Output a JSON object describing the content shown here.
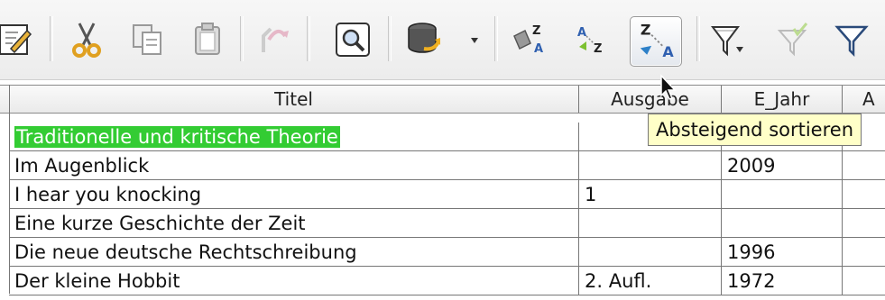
{
  "toolbar": {
    "buttons": [
      {
        "name": "edit-data-button",
        "icon": "edit-icon"
      },
      {
        "name": "cut-button",
        "icon": "scissors-icon"
      },
      {
        "name": "copy-button",
        "icon": "copy-icon"
      },
      {
        "name": "paste-button",
        "icon": "paste-icon"
      },
      {
        "name": "undo-button",
        "icon": "undo-icon"
      },
      {
        "name": "find-record-button",
        "icon": "magnifier-icon"
      },
      {
        "name": "data-source-button",
        "icon": "database-icon"
      },
      {
        "name": "sort-button",
        "icon": "sort-icon"
      },
      {
        "name": "sort-ascending-button",
        "icon": "sort-ascending-icon"
      },
      {
        "name": "sort-descending-button",
        "icon": "sort-descending-icon"
      },
      {
        "name": "autofilter-button",
        "icon": "funnel-icon"
      },
      {
        "name": "apply-filter-button",
        "icon": "funnel-check-icon"
      },
      {
        "name": "standard-filter-button",
        "icon": "funnel-outline-icon"
      }
    ],
    "glyphs": {
      "sort_z": "Z",
      "sort_a": "A",
      "asc_a": "A",
      "asc_z": "Z",
      "desc_z": "Z",
      "desc_a": "A"
    }
  },
  "tooltip": "Absteigend sortieren",
  "table": {
    "columns": [
      "Titel",
      "Ausgabe",
      "E_Jahr",
      "A"
    ],
    "rows": [
      [
        "Traditionelle und kritische Theorie",
        "",
        ""
      ],
      [
        "Im Augenblick",
        "",
        "2009"
      ],
      [
        "I hear you knocking",
        "1",
        ""
      ],
      [
        "Eine kurze Geschichte der Zeit",
        "",
        ""
      ],
      [
        "Die neue deutsche Rechtschreibung",
        "",
        "1996"
      ],
      [
        "Der kleine Hobbit",
        "2. Aufl.",
        "1972"
      ]
    ]
  },
  "colors": {
    "selection": "#33cc33",
    "tooltip_bg": "#ffffc8",
    "grid_line": "#777777"
  }
}
